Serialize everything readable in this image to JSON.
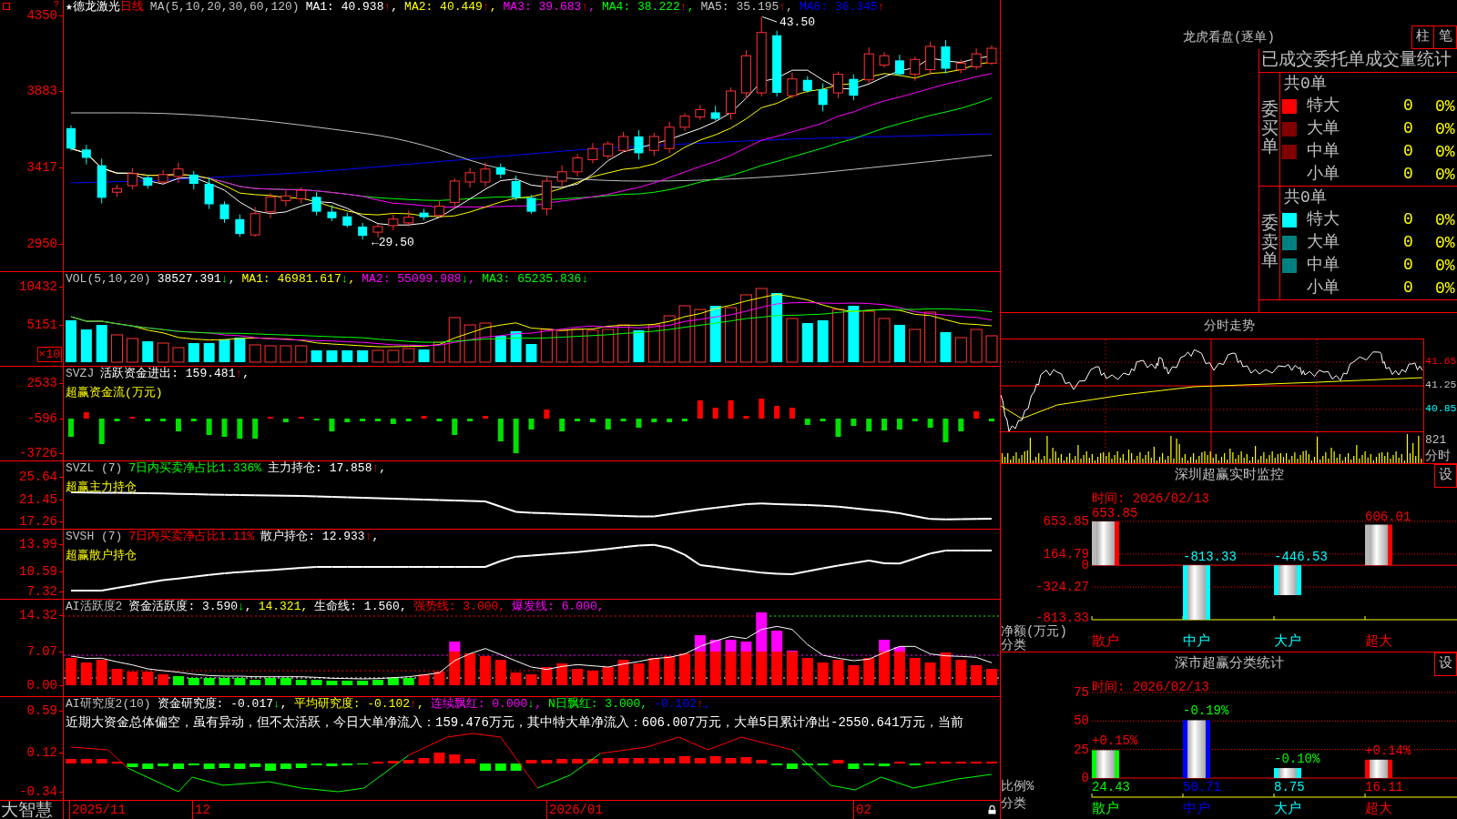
{
  "main_chart": {
    "help_mark": "?",
    "stock": "★德龙激光",
    "period": "日线",
    "title": "MA(5,10,20,30,60,120)",
    "readings": [
      {
        "text": "MA1: 40.938",
        "color": "#ffffff",
        "arrow": "↑",
        "rising": true,
        "suffix": ","
      },
      {
        "text": "MA2: 40.449",
        "color": "#ffff00",
        "arrow": "↑",
        "rising": true,
        "suffix": ","
      },
      {
        "text": "MA3: 39.683",
        "color": "#ff00ff",
        "arrow": "↑",
        "rising": true,
        "suffix": ","
      },
      {
        "text": "MA4: 38.222",
        "color": "#00ff00",
        "arrow": "↑",
        "rising": true,
        "suffix": ","
      },
      {
        "text": "MA5: 35.195",
        "color": "#c0c0c0",
        "arrow": "↑",
        "rising": true,
        "suffix": ","
      },
      {
        "text": "MA6: 36.345",
        "color": "#0000ff",
        "arrow": "↑",
        "rising": true
      }
    ],
    "axis_labels": [
      "4350",
      "3883",
      "3417",
      "2950"
    ],
    "peak_label": "43.50",
    "low_label": "←29.50"
  },
  "volume_panel": {
    "title": "VOL(5,10,20)",
    "readings": [
      {
        "text": "38527.391",
        "color": "#ffffff",
        "arrow": "↓",
        "rising": false,
        "suffix": ","
      },
      {
        "text": "MA1: 46981.617",
        "color": "#ffff00",
        "arrow": "↓",
        "rising": false,
        "suffix": ","
      },
      {
        "text": "MA2: 55099.988",
        "color": "#ff00ff",
        "arrow": "↓",
        "rising": false,
        "suffix": ","
      },
      {
        "text": "MA3: 65235.836",
        "color": "#00ff00",
        "arrow": "↓",
        "rising": false
      }
    ],
    "axis_labels": [
      "10432",
      "5151"
    ],
    "unit_label": "×10"
  },
  "fund_flow_panel": {
    "title": "SVZJ",
    "readings": [
      {
        "text": "活跃资金进出: 159.481",
        "color": "#ffffff",
        "arrow": "↑",
        "rising": true,
        "suffix": ","
      }
    ],
    "caption": "超赢资金流(万元)",
    "axis_labels": [
      "2533",
      "-596",
      "-3726"
    ]
  },
  "main_force_panel": {
    "title": "SVZL (7)",
    "readings": [
      {
        "text": "7日内买卖净占比1.336%",
        "color": "#00ff00"
      },
      {
        "text": "主力持仓: 17.858",
        "color": "#ffffff",
        "arrow": "↑",
        "rising": true,
        "suffix": ","
      }
    ],
    "caption": "超赢主力持仓",
    "axis_labels": [
      "25.64",
      "21.45",
      "17.26"
    ]
  },
  "retail_panel": {
    "title": "SVSH (7)",
    "readings": [
      {
        "text": "7日内买卖净占比1.11%",
        "color": "#ff0000"
      },
      {
        "text": "散户持仓: 12.933",
        "color": "#ffffff",
        "arrow": "↑",
        "rising": true,
        "suffix": ","
      }
    ],
    "caption": "超赢散户持仓",
    "axis_labels": [
      "13.99",
      "10.59",
      "7.32"
    ]
  },
  "activity_panel": {
    "title": "AI活跃度2",
    "readings": [
      {
        "text": "资金活跃度: 3.590",
        "color": "#ffffff",
        "arrow": "↓",
        "rising": false,
        "suffix": ","
      },
      {
        "text": "14.321",
        "color": "#ffff00",
        "suffix": ","
      },
      {
        "text": "生命线: 1.560",
        "color": "#ffffff",
        "suffix": ","
      },
      {
        "text": "强势线: 3.000",
        "color": "#ff0000",
        "suffix": ","
      },
      {
        "text": "爆发线: 6.000",
        "color": "#ff00ff",
        "suffix": ","
      }
    ],
    "axis_labels": [
      "14.32",
      "7.07",
      "0.00"
    ]
  },
  "research_panel": {
    "title": "AI研究度2(10)",
    "readings": [
      {
        "text": "资金研究度: -0.017",
        "color": "#ffffff",
        "arrow": "↓",
        "rising": false,
        "suffix": ","
      },
      {
        "text": "平均研究度: -0.102",
        "color": "#ffff00",
        "arrow": "↑",
        "rising": true,
        "suffix": ","
      },
      {
        "text": "连续飘红: 0.000",
        "color": "#ff00ff",
        "arrow": "↓",
        "rising": false,
        "suffix": ","
      },
      {
        "text": "N日飘红: 3.000",
        "color": "#00ff00",
        "suffix": ","
      },
      {
        "text": "-0.102",
        "color": "#0000ff",
        "arrow": "↑",
        "rising": true,
        "suffix": ","
      }
    ],
    "commentary": "近期大资金总体偏空，虽有异动，但不太活跃，今日大单净流入：159.476万元，其中特大单净流入：606.007万元，大单5日累计净出-2550.641万元，当前",
    "axis_labels": [
      "0.59",
      "0.12",
      "-0.34"
    ]
  },
  "time_axis": {
    "brand": "大智慧",
    "dates": [
      "2025/11",
      "12",
      "2026/01",
      "02"
    ]
  },
  "order_monitor": {
    "title": "龙虎看盘(逐单)",
    "view_buttons": [
      "柱",
      "笔"
    ],
    "table": {
      "title": "已成交委托单成交量统计",
      "sections": [
        {
          "label": "委买单",
          "total": "共0单",
          "rows": [
            {
              "label": "特大",
              "count": "0",
              "share": "0%",
              "color": "#ff0000"
            },
            {
              "label": "大单",
              "count": "0",
              "share": "0%",
              "color": "#800000"
            },
            {
              "label": "中单",
              "count": "0",
              "share": "0%",
              "color": "#800000"
            },
            {
              "label": "小单",
              "count": "0",
              "share": "0%"
            }
          ]
        },
        {
          "label": "委卖单",
          "total": "共0单",
          "rows": [
            {
              "label": "特大",
              "count": "0",
              "share": "0%",
              "color": "#00ffff"
            },
            {
              "label": "大单",
              "count": "0",
              "share": "0%",
              "color": "#008080"
            },
            {
              "label": "中单",
              "count": "0",
              "share": "0%",
              "color": "#008080"
            },
            {
              "label": "小单",
              "count": "0",
              "share": "0%"
            }
          ]
        }
      ]
    }
  },
  "intraday": {
    "title": "分时走势",
    "price_labels": [
      {
        "text": "41.65",
        "color": "#ff0000"
      },
      {
        "text": "41.25",
        "color": "#c0c0c0"
      },
      {
        "text": "40.85",
        "color": "#00ffff"
      }
    ],
    "volume_label": "821",
    "unit_label": "分时"
  },
  "sz_monitor": {
    "title": "深圳超赢实时监控",
    "settings_button": "设",
    "time": "时间: 2026/02/13",
    "chart_data": {
      "type": "bar",
      "xlabel": "分类",
      "ylabel": "净额(万元)",
      "categories": [
        "散户",
        "中户",
        "大户",
        "超大"
      ],
      "values": [
        653.85,
        -813.33,
        -446.53,
        606.01
      ],
      "value_labels": [
        "653.85",
        "-813.33",
        "-446.53",
        "606.01"
      ],
      "ylim": [
        -813.33,
        653.85
      ],
      "yticks": [
        {
          "value": 653.85,
          "label": "653.85"
        },
        {
          "value": 164.79,
          "label": "164.79"
        },
        {
          "value": 0,
          "label": "0"
        },
        {
          "value": -324.27,
          "label": "-324.27"
        },
        {
          "value": -813.33,
          "label": "-813.33"
        }
      ],
      "ref_lines": [
        {
          "axis": "y",
          "value": 0
        }
      ]
    }
  },
  "sz_stats": {
    "title": "深市超赢分类统计",
    "settings_button": "设",
    "time": "时间: 2026/02/13",
    "bars": [
      {
        "change": "+0.15%",
        "rising": true,
        "color": "#00ff00"
      },
      {
        "change": "-0.19%",
        "rising": false,
        "color": "#0000ff"
      },
      {
        "change": "-0.10%",
        "rising": false,
        "color": "#00ffff"
      },
      {
        "change": "+0.14%",
        "rising": true,
        "color": "#ff0000"
      }
    ],
    "chart_data": {
      "type": "bar",
      "xlabel": "分类",
      "ylabel": "比例%",
      "categories": [
        "散户",
        "中户",
        "大户",
        "超大"
      ],
      "values": [
        24.43,
        50.71,
        8.75,
        16.11
      ],
      "value_labels": [
        "24.43",
        "50.71",
        "8.75",
        "16.11"
      ],
      "ylim": [
        0,
        75
      ],
      "yticks": [
        0,
        25,
        50,
        75
      ]
    }
  }
}
